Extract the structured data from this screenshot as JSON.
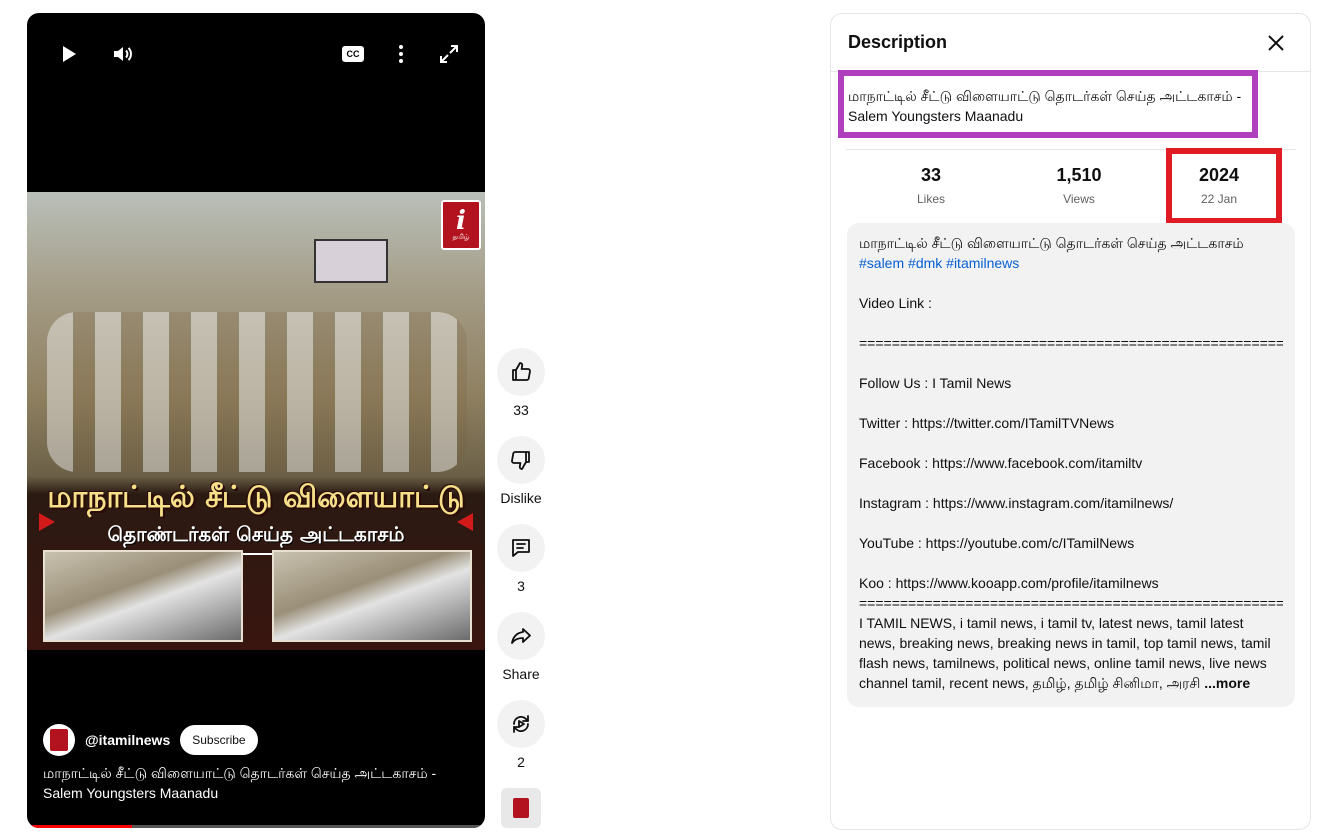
{
  "player": {
    "controls": {
      "play": "play-icon",
      "volume": "volume-icon",
      "cc": "CC",
      "more": "more-vert-icon",
      "fullscreen": "fullscreen-icon"
    },
    "thumbnail": {
      "headline": "மாநாட்டில் சீட்டு விளையாட்டு",
      "subline": "தொண்டர்கள் செய்த அட்டகாசம்",
      "badge_letter": "i",
      "badge_text": "தமிழ்"
    },
    "channel_handle": "@itamilnews",
    "subscribe_label": "Subscribe",
    "title": "மாநாட்டில் சீட்டு விளையாட்டு தொடர்கள் செய்த அட்டகாசம் - Salem Youngsters Maanadu",
    "progress_fraction": 0.23
  },
  "actions": {
    "like_count": "33",
    "dislike_label": "Dislike",
    "comment_count": "3",
    "share_label": "Share",
    "remix_count": "2"
  },
  "panel": {
    "heading": "Description",
    "video_title": "மாநாட்டில் சீட்டு விளையாட்டு தொடர்கள் செய்த அட்டகாசம் - Salem Youngsters Maanadu",
    "stats": {
      "likes_value": "33",
      "likes_label": "Likes",
      "views_value": "1,510",
      "views_label": "Views",
      "year": "2024",
      "date": "22 Jan"
    },
    "description": {
      "line1": "மாநாட்டில் சீட்டு விளையாட்டு தொடர்கள் செய்த அட்டகாசம்",
      "tags": [
        "#salem",
        "#dmk",
        "#itamilnews"
      ],
      "video_link": "Video Link :",
      "separator": "==========================================================================",
      "follow": "Follow Us : I Tamil News",
      "twitter": "Twitter : https://twitter.com/ITamilTVNews",
      "facebook": "Facebook : https://www.facebook.com/itamiltv",
      "instagram": "Instagram : https://www.instagram.com/itamilnews/",
      "youtube": "YouTube : https://youtube.com/c/ITamilNews",
      "koo": "Koo : https://www.kooapp.com/profile/itamilnews",
      "keywords": "I TAMIL NEWS, i tamil news, i tamil tv, latest news, tamil latest news, breaking news, breaking news in tamil, top tamil news, tamil flash news, tamilnews, political news, online tamil news, live news channel tamil, recent news, தமிழ், தமிழ் சினிமா, அரசி",
      "more_label": "...more"
    }
  }
}
